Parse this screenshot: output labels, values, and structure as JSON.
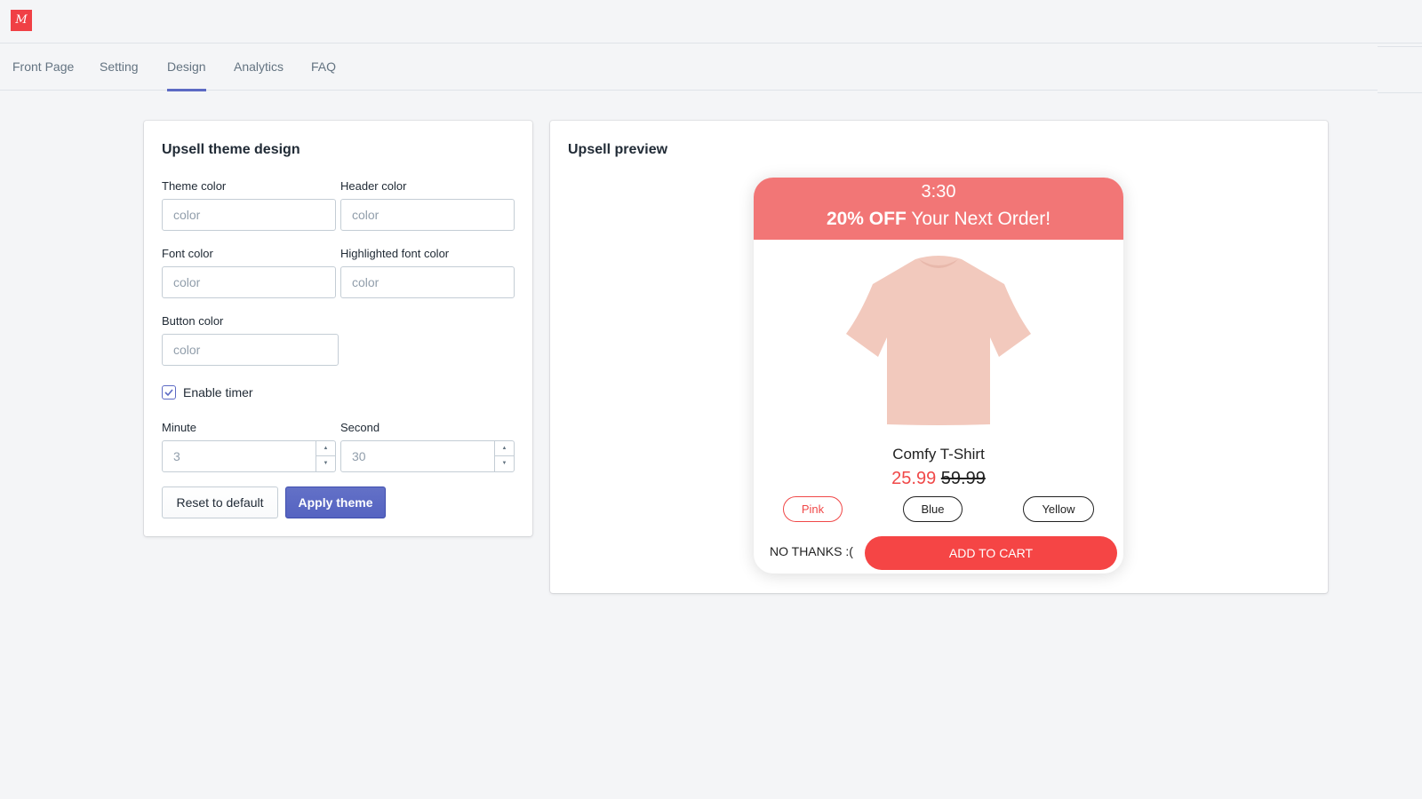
{
  "app": {
    "logo_glyph": "M",
    "logo_color": "#f04045"
  },
  "tabs": [
    {
      "label": "Front Page",
      "active": false
    },
    {
      "label": "Setting",
      "active": false
    },
    {
      "label": "Design",
      "active": true
    },
    {
      "label": "Analytics",
      "active": false
    },
    {
      "label": "FAQ",
      "active": false
    }
  ],
  "design_card": {
    "title": "Upsell theme design",
    "fields": {
      "theme_color": {
        "label": "Theme color",
        "value": "",
        "placeholder": "color"
      },
      "header_color": {
        "label": "Header color",
        "value": "",
        "placeholder": "color"
      },
      "font_color": {
        "label": "Font color",
        "value": "",
        "placeholder": "color"
      },
      "highlighted_font_color": {
        "label": "Highlighted font color",
        "value": "",
        "placeholder": "color"
      },
      "button_color": {
        "label": "Button color",
        "value": "",
        "placeholder": "color"
      }
    },
    "enable_timer": {
      "label": "Enable timer",
      "checked": true
    },
    "minute": {
      "label": "Minute",
      "value": "3"
    },
    "second": {
      "label": "Second",
      "value": "30"
    },
    "reset_label": "Reset to default",
    "apply_label": "Apply theme",
    "accent_color": "#5c6ac4"
  },
  "preview_card": {
    "title": "Upsell preview",
    "popup": {
      "timer": "3:30",
      "headline_bold": "20% OFF",
      "headline_rest": " Your Next Order!",
      "header_color": "#f27676",
      "product_image": "pink-tshirt-image",
      "product_name": "Comfy T-Shirt",
      "price_sale": "25.99",
      "price_original": "59.99",
      "variants": [
        {
          "label": "Pink",
          "selected": true
        },
        {
          "label": "Blue",
          "selected": false
        },
        {
          "label": "Yellow",
          "selected": false
        }
      ],
      "decline_label": "NO THANKS :(",
      "cta_label": "ADD TO CART",
      "cta_color": "#f54545"
    }
  }
}
